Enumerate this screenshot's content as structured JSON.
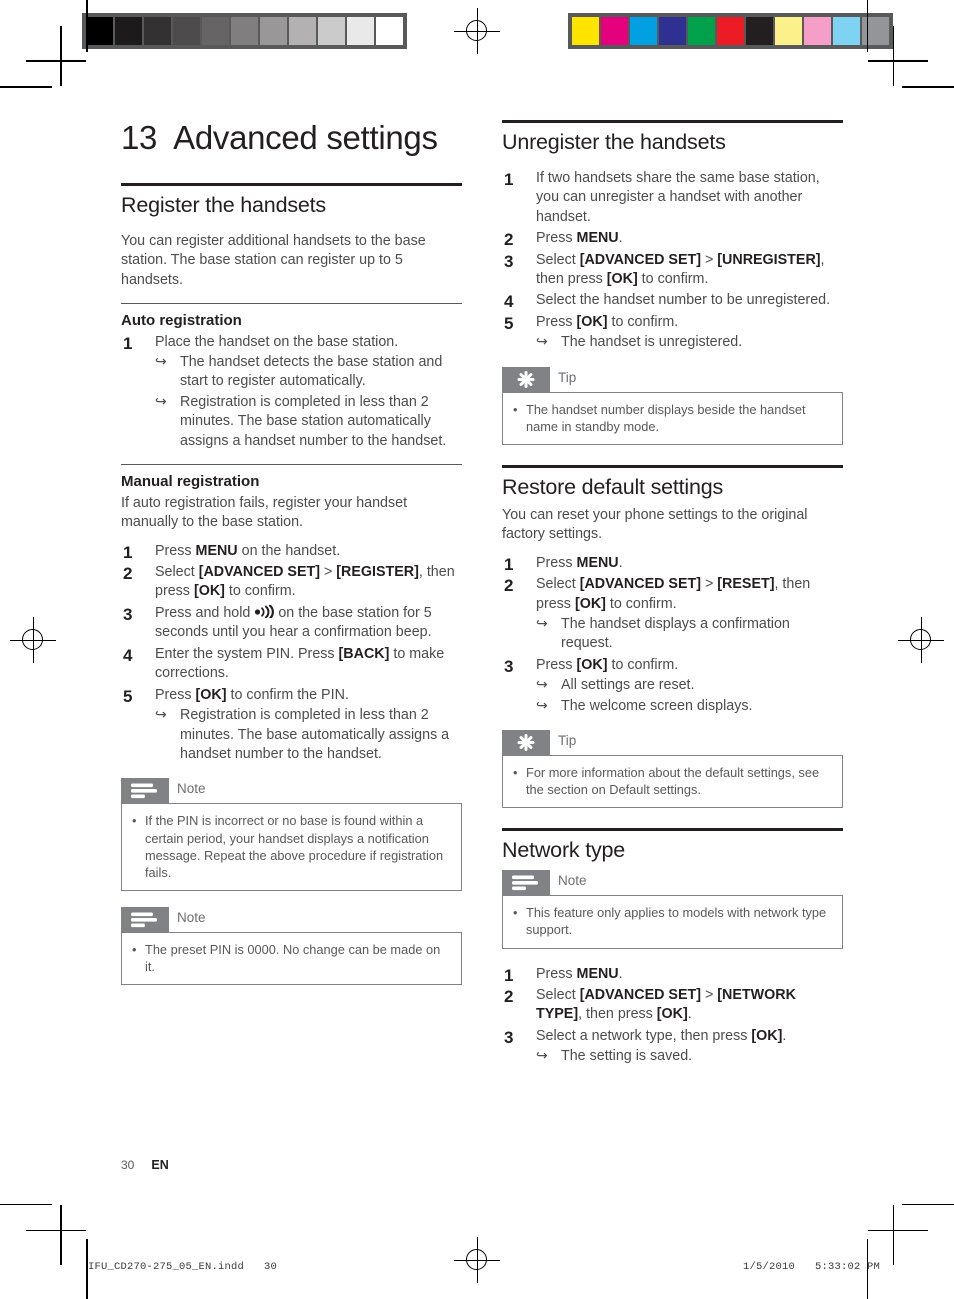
{
  "document": {
    "page_number": "30",
    "language_code": "EN",
    "slug_file": "IFU_CD270-275_05_EN.indd",
    "slug_page": "30",
    "slug_date": "1/5/2010",
    "slug_time": "5:33:02 PM"
  },
  "print_marks": {
    "gray_swatches": [
      "#000000",
      "#1c1a1b",
      "#333132",
      "#4d4b4c",
      "#666465",
      "#807e7f",
      "#999798",
      "#b3b1b2",
      "#cccbcb",
      "#e9e9e9",
      "#ffffff"
    ],
    "color_swatches": [
      "#ffe400",
      "#e5007e",
      "#00a0e3",
      "#2e3192",
      "#00a14b",
      "#ed1c24",
      "#231f20",
      "#fbf08a",
      "#f59ec8",
      "#7ed3f2",
      "#939598"
    ]
  },
  "chapter": {
    "number": "13",
    "title": "Advanced settings"
  },
  "left_column": {
    "section": {
      "heading": "Register the handsets",
      "intro": "You can register additional handsets to the base station. The base station can register up to 5 handsets."
    },
    "auto_registration": {
      "heading": "Auto registration",
      "steps": [
        {
          "num": "1",
          "text": "Place the handset on the base station.",
          "results": [
            "The handset detects the base station and start to register automatically.",
            "Registration is completed in less than 2 minutes. The base station automatically assigns a handset number to the handset."
          ]
        }
      ]
    },
    "manual_registration": {
      "heading": "Manual registration",
      "intro": "If auto registration fails, register your handset manually to the base station.",
      "steps": [
        {
          "num": "1",
          "text_parts": [
            "Press ",
            "MENU",
            " on the handset."
          ]
        },
        {
          "num": "2",
          "text_parts": [
            "Select ",
            "[ADVANCED SET]",
            " > ",
            "[REGISTER]",
            ", then press ",
            "[OK]",
            " to confirm."
          ]
        },
        {
          "num": "3",
          "text_parts": [
            "Press and hold ",
            "paging-icon",
            " on the base station for 5 seconds until you hear a confirmation beep."
          ]
        },
        {
          "num": "4",
          "text_parts": [
            "Enter the system PIN. Press ",
            "[BACK]",
            " to make corrections."
          ]
        },
        {
          "num": "5",
          "text_parts": [
            "Press ",
            "[OK]",
            " to confirm the PIN."
          ],
          "results": [
            "Registration is completed in less than 2 minutes. The base automatically assigns a handset number to the handset."
          ]
        }
      ]
    },
    "notes": [
      {
        "icon": "note-icon",
        "title": "Note",
        "items": [
          "If the PIN is incorrect or no base is found within a certain period, your handset displays a notification message. Repeat the above procedure if registration fails."
        ]
      },
      {
        "icon": "note-icon",
        "title": "Note",
        "items": [
          "The preset PIN is 0000. No change can be made on it."
        ]
      }
    ]
  },
  "right_column": {
    "unregister": {
      "heading": "Unregister the handsets",
      "steps": [
        {
          "num": "1",
          "text_parts": [
            "If two handsets share the same base station, you can unregister a handset with another handset."
          ]
        },
        {
          "num": "2",
          "text_parts": [
            "Press ",
            "MENU",
            "."
          ]
        },
        {
          "num": "3",
          "text_parts": [
            "Select ",
            "[ADVANCED SET]",
            " > ",
            "[UNREGISTER]",
            ", then press ",
            "[OK]",
            " to confirm."
          ]
        },
        {
          "num": "4",
          "text_parts": [
            "Select the handset number to be unregistered."
          ]
        },
        {
          "num": "5",
          "text_parts": [
            "Press ",
            "[OK]",
            " to confirm."
          ],
          "results": [
            "The handset is unregistered."
          ]
        }
      ],
      "tip": {
        "icon": "tip-icon",
        "title": "Tip",
        "items": [
          "The handset number displays beside the handset name in standby mode."
        ]
      }
    },
    "restore": {
      "heading": "Restore default settings",
      "intro": "You can reset your phone settings to the original factory settings.",
      "steps": [
        {
          "num": "1",
          "text_parts": [
            "Press ",
            "MENU",
            "."
          ]
        },
        {
          "num": "2",
          "text_parts": [
            "Select ",
            "[ADVANCED SET]",
            " > ",
            "[RESET]",
            ", then press ",
            "[OK]",
            " to confirm."
          ],
          "results": [
            "The handset displays a confirmation request."
          ]
        },
        {
          "num": "3",
          "text_parts": [
            "Press ",
            "[OK]",
            " to confirm."
          ],
          "results": [
            "All settings are reset.",
            "The welcome screen displays."
          ]
        }
      ],
      "tip": {
        "icon": "tip-icon",
        "title": "Tip",
        "items": [
          "For more information about the default settings, see the section on Default settings."
        ]
      }
    },
    "network_type": {
      "heading": "Network type",
      "note": {
        "icon": "note-icon",
        "title": "Note",
        "items": [
          "This feature only applies to models with network type support."
        ]
      },
      "steps": [
        {
          "num": "1",
          "text_parts": [
            "Press ",
            "MENU",
            "."
          ]
        },
        {
          "num": "2",
          "text_parts": [
            "Select ",
            "[ADVANCED SET]",
            " > ",
            "[NETWORK TYPE]",
            ", then press ",
            "[OK]",
            "."
          ]
        },
        {
          "num": "3",
          "text_parts": [
            "Select a network type, then press ",
            "[OK]",
            "."
          ],
          "results": [
            "The setting is saved."
          ]
        }
      ]
    }
  }
}
